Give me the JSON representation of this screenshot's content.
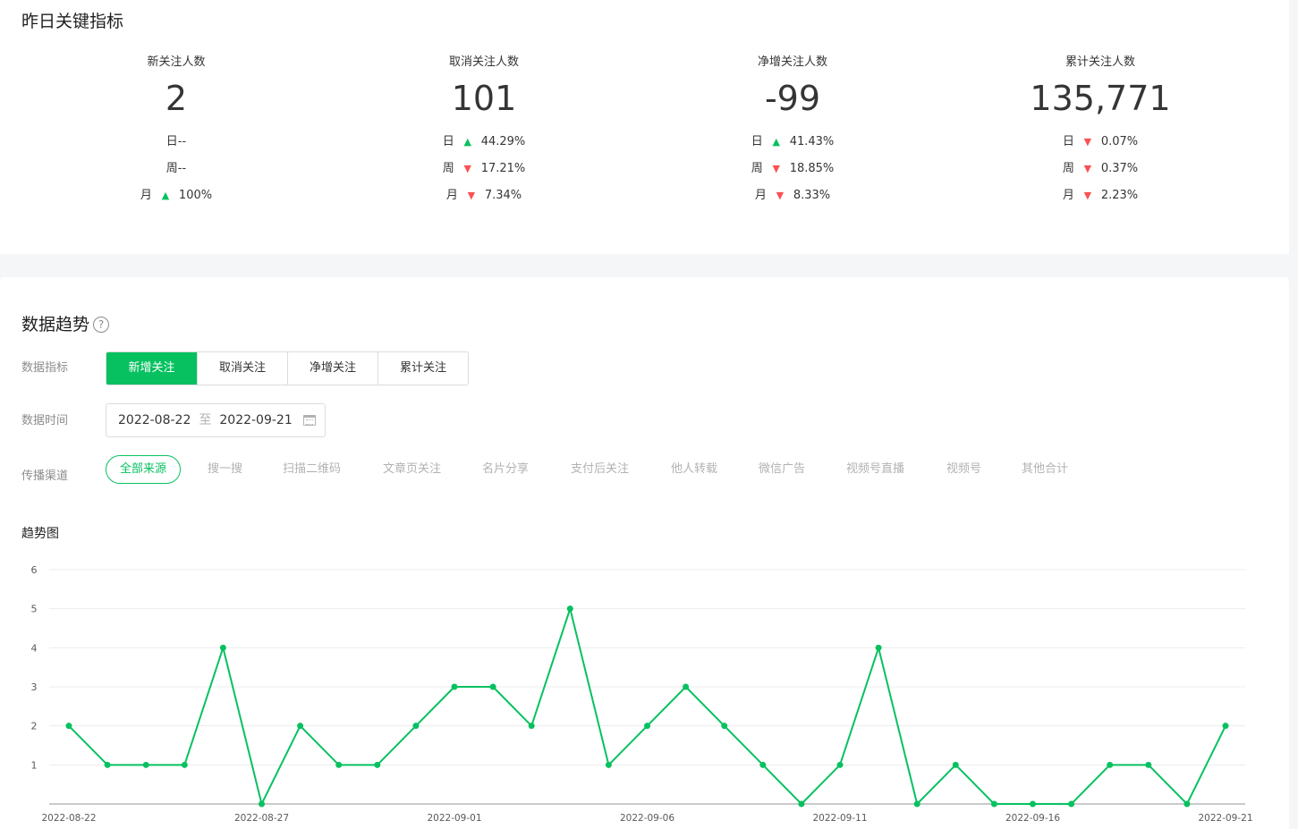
{
  "kpi_section": {
    "title": "昨日关键指标",
    "cards": [
      {
        "label": "新关注人数",
        "value": "2",
        "rows": [
          {
            "text": "日--",
            "arrow": "",
            "pct": ""
          },
          {
            "text": "周--",
            "arrow": "",
            "pct": ""
          },
          {
            "text": "月",
            "arrow": "up",
            "pct": "100%"
          }
        ]
      },
      {
        "label": "取消关注人数",
        "value": "101",
        "rows": [
          {
            "text": "日",
            "arrow": "up",
            "pct": "44.29%"
          },
          {
            "text": "周",
            "arrow": "down",
            "pct": "17.21%"
          },
          {
            "text": "月",
            "arrow": "down",
            "pct": "7.34%"
          }
        ]
      },
      {
        "label": "净增关注人数",
        "value": "-99",
        "rows": [
          {
            "text": "日",
            "arrow": "up",
            "pct": "41.43%"
          },
          {
            "text": "周",
            "arrow": "down",
            "pct": "18.85%"
          },
          {
            "text": "月",
            "arrow": "down",
            "pct": "8.33%"
          }
        ]
      },
      {
        "label": "累计关注人数",
        "value": "135,771",
        "rows": [
          {
            "text": "日",
            "arrow": "down",
            "pct": "0.07%"
          },
          {
            "text": "周",
            "arrow": "down",
            "pct": "0.37%"
          },
          {
            "text": "月",
            "arrow": "down",
            "pct": "2.23%"
          }
        ]
      }
    ]
  },
  "trend_section": {
    "title": "数据趋势",
    "help_glyph": "?",
    "metric_label": "数据指标",
    "metric_tabs": [
      "新增关注",
      "取消关注",
      "净增关注",
      "累计关注"
    ],
    "metric_active": 0,
    "time_label": "数据时间",
    "date_start": "2022-08-22",
    "date_sep": "至",
    "date_end": "2022-09-21",
    "channel_label": "传播渠道",
    "channels": [
      "全部来源",
      "搜一搜",
      "扫描二维码",
      "文章页关注",
      "名片分享",
      "支付后关注",
      "他人转载",
      "微信广告",
      "视频号直播",
      "视频号",
      "其他合计"
    ],
    "channel_active": 0,
    "chart_title": "趋势图"
  },
  "colors": {
    "accent": "#07c160",
    "down": "#fa5151",
    "muted": "#b2b2b2"
  },
  "chart_data": {
    "type": "line",
    "x": [
      "2022-08-22",
      "2022-08-23",
      "2022-08-24",
      "2022-08-25",
      "2022-08-26",
      "2022-08-27",
      "2022-08-28",
      "2022-08-29",
      "2022-08-30",
      "2022-08-31",
      "2022-09-01",
      "2022-09-02",
      "2022-09-03",
      "2022-09-04",
      "2022-09-05",
      "2022-09-06",
      "2022-09-07",
      "2022-09-08",
      "2022-09-09",
      "2022-09-10",
      "2022-09-11",
      "2022-09-12",
      "2022-09-13",
      "2022-09-14",
      "2022-09-15",
      "2022-09-16",
      "2022-09-17",
      "2022-09-18",
      "2022-09-19",
      "2022-09-20",
      "2022-09-21"
    ],
    "series": [
      {
        "values": [
          2,
          1,
          1,
          1,
          4,
          0,
          2,
          1,
          1,
          2,
          3,
          3,
          2,
          5,
          1,
          2,
          3,
          2,
          1,
          0,
          1,
          4,
          0,
          1,
          0,
          0,
          0,
          1,
          1,
          0,
          2
        ]
      }
    ],
    "x_tick_labels": [
      "2022-08-22",
      "2022-08-27",
      "2022-09-01",
      "2022-09-06",
      "2022-09-11",
      "2022-09-16",
      "2022-09-21"
    ],
    "y_ticks": [
      1,
      2,
      3,
      4,
      5,
      6
    ],
    "ylim": [
      0,
      6
    ],
    "grid": true,
    "legend": false,
    "color": "#07c160"
  }
}
